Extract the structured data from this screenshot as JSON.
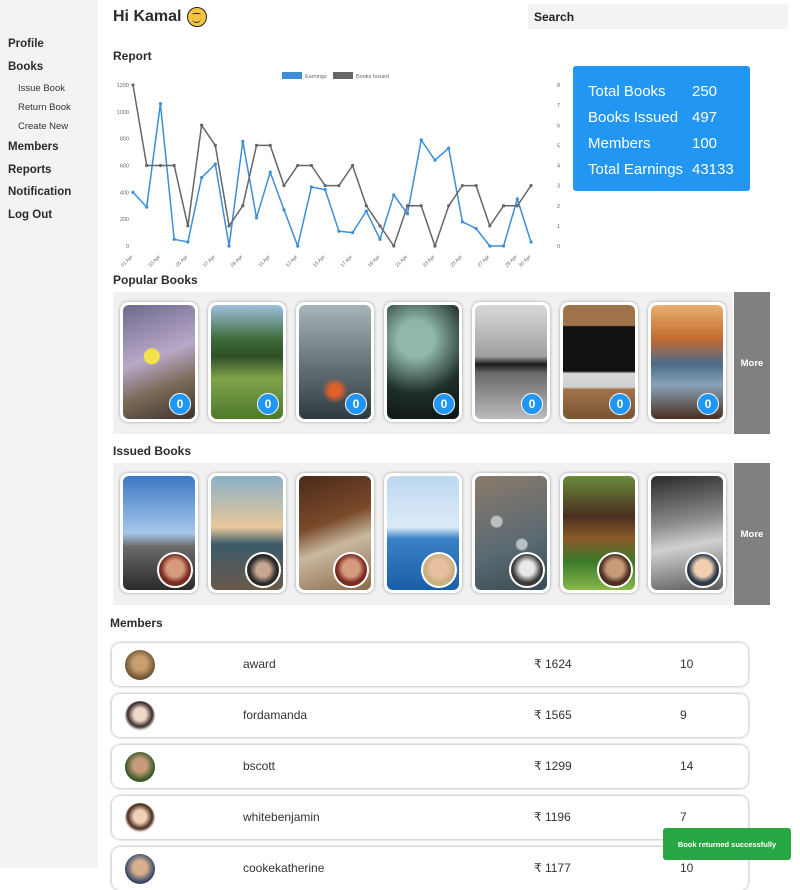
{
  "sidebar": {
    "items": [
      {
        "label": "Profile"
      },
      {
        "label": "Books",
        "children": [
          {
            "label": "Issue Book"
          },
          {
            "label": "Return Book"
          },
          {
            "label": "Create New"
          }
        ]
      },
      {
        "label": "Members"
      },
      {
        "label": "Reports"
      },
      {
        "label": "Notification"
      },
      {
        "label": "Log Out"
      }
    ]
  },
  "header": {
    "greeting": "Hi Kamal",
    "greeting_icon": "smiley-icon",
    "search_placeholder": "Search"
  },
  "report": {
    "title": "Report"
  },
  "chart_data": {
    "type": "line",
    "legend": [
      "Earnings",
      "Books Issued"
    ],
    "legend_position": "top-center",
    "grid": false,
    "x": [
      "01 Apr",
      "02 Apr",
      "03 Apr",
      "04 Apr",
      "05 Apr",
      "06 Apr",
      "07 Apr",
      "08 Apr",
      "09 Apr",
      "10 Apr",
      "11 Apr",
      "12 Apr",
      "13 Apr",
      "14 Apr",
      "15 Apr",
      "16 Apr",
      "17 Apr",
      "18 Apr",
      "19 Apr",
      "20 Apr",
      "21 Apr",
      "22 Apr",
      "23 Apr",
      "24 Apr",
      "25 Apr",
      "26 Apr",
      "27 Apr",
      "28 Apr",
      "29 Apr",
      "30 Apr"
    ],
    "x_tick_labels": [
      "01 Apr",
      "03 Apr",
      "05 Apr",
      "07 Apr",
      "09 Apr",
      "11 Apr",
      "13 Apr",
      "15 Apr",
      "17 Apr",
      "19 Apr",
      "21 Apr",
      "23 Apr",
      "25 Apr",
      "27 Apr",
      "29 Apr",
      "30 Apr"
    ],
    "y_left_ticks": [
      0,
      200,
      400,
      600,
      800,
      1000,
      1200
    ],
    "y_right_ticks": [
      0,
      1,
      2,
      3,
      4,
      5,
      6,
      7,
      8
    ],
    "ylim_left": [
      0,
      1200
    ],
    "ylim_right": [
      0,
      8
    ],
    "series": [
      {
        "name": "Earnings",
        "axis": "left",
        "color": "#3b8ed8",
        "values": [
          400,
          290,
          1060,
          50,
          30,
          510,
          610,
          0,
          780,
          210,
          550,
          270,
          0,
          440,
          420,
          110,
          100,
          260,
          50,
          380,
          240,
          790,
          640,
          730,
          180,
          130,
          0,
          0,
          350,
          30
        ]
      },
      {
        "name": "Books Issued",
        "axis": "right",
        "color": "#666666",
        "values": [
          8,
          4,
          4,
          4,
          1,
          6,
          5,
          1,
          2,
          5,
          5,
          3,
          4,
          4,
          3,
          3,
          4,
          2,
          1,
          0,
          2,
          2,
          0,
          2,
          3,
          3,
          1,
          2,
          2,
          3
        ]
      }
    ]
  },
  "stats": {
    "rows": [
      {
        "label": "Total Books",
        "value": "250"
      },
      {
        "label": "Books Issued",
        "value": "497"
      },
      {
        "label": "Members",
        "value": "100"
      },
      {
        "label": "Total Earnings",
        "value": "43133"
      }
    ],
    "color": "#2196f3"
  },
  "popular_books": {
    "title": "Popular Books",
    "more_label": "More",
    "items": [
      {
        "count": "0"
      },
      {
        "count": "0"
      },
      {
        "count": "0"
      },
      {
        "count": "0"
      },
      {
        "count": "0"
      },
      {
        "count": "0"
      },
      {
        "count": "0"
      }
    ]
  },
  "issued_books": {
    "title": "Issued Books",
    "more_label": "More"
  },
  "members": {
    "title": "Members",
    "rows": [
      {
        "name": "award",
        "amount": "₹ 1624",
        "count": "10"
      },
      {
        "name": "fordamanda",
        "amount": "₹ 1565",
        "count": "9"
      },
      {
        "name": "bscott",
        "amount": "₹ 1299",
        "count": "14"
      },
      {
        "name": "whitebenjamin",
        "amount": "₹ 1196",
        "count": "7"
      },
      {
        "name": "cookekatherine",
        "amount": "₹ 1177",
        "count": "10"
      }
    ]
  },
  "toast": {
    "message": "Book returned successfully",
    "color": "#28a745"
  }
}
